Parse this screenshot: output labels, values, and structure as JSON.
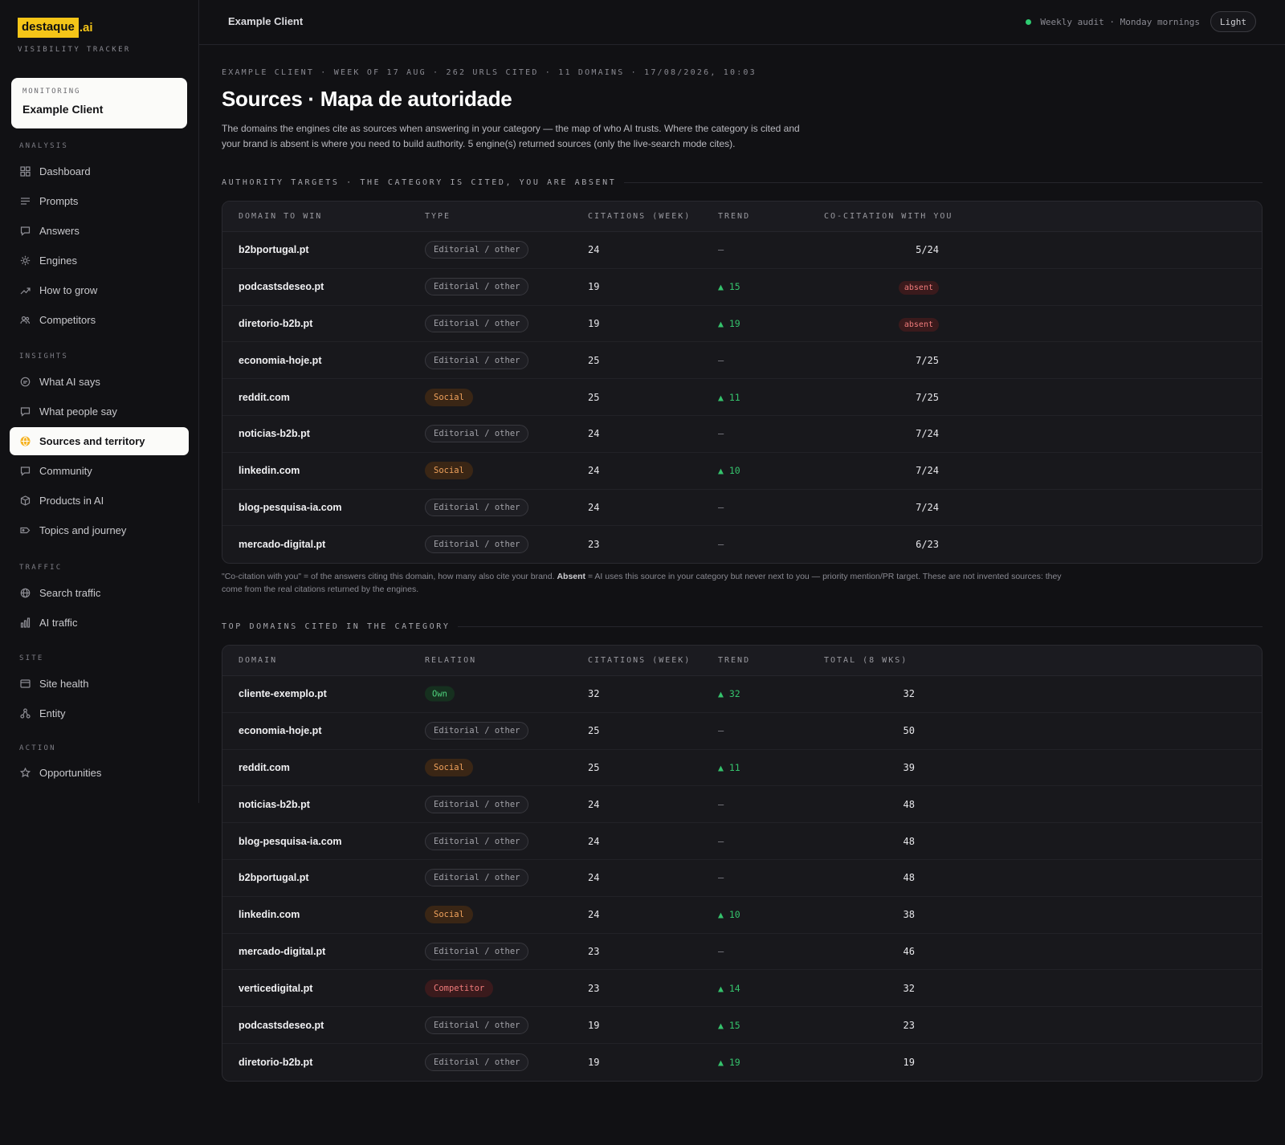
{
  "brand": {
    "name": "destaque",
    "ext": ".ai",
    "subtitle": "VISIBILITY TRACKER"
  },
  "client_card": {
    "label": "MONITORING",
    "name": "Example Client"
  },
  "nav": {
    "sections": [
      {
        "label": "ANALYSIS",
        "items": [
          {
            "label": "Dashboard",
            "icon": "grid-icon"
          },
          {
            "label": "Prompts",
            "icon": "lines-icon"
          },
          {
            "label": "Answers",
            "icon": "chat-icon"
          },
          {
            "label": "Engines",
            "icon": "gear-icon"
          },
          {
            "label": "How to grow",
            "icon": "trend-icon"
          },
          {
            "label": "Competitors",
            "icon": "users-icon"
          }
        ]
      },
      {
        "label": "INSIGHTS",
        "items": [
          {
            "label": "What AI says",
            "icon": "circle-icon"
          },
          {
            "label": "What people say",
            "icon": "chat-icon"
          },
          {
            "label": "Sources and territory",
            "icon": "globe-icon",
            "active": true
          },
          {
            "label": "Community",
            "icon": "chat-icon"
          },
          {
            "label": "Products in AI",
            "icon": "box-icon"
          },
          {
            "label": "Topics and journey",
            "icon": "tag-icon"
          }
        ]
      },
      {
        "label": "TRAFFIC",
        "items": [
          {
            "label": "Search traffic",
            "icon": "globe-icon"
          },
          {
            "label": "AI traffic",
            "icon": "bars-icon"
          }
        ]
      },
      {
        "label": "SITE",
        "items": [
          {
            "label": "Site health",
            "icon": "window-icon"
          },
          {
            "label": "Entity",
            "icon": "nodes-icon"
          }
        ]
      },
      {
        "label": "ACTION",
        "items": [
          {
            "label": "Opportunities",
            "icon": "star-icon"
          }
        ]
      }
    ]
  },
  "topbar": {
    "breadcrumb": "Example Client",
    "status": "Weekly audit · Monday mornings",
    "theme_button": "Light",
    "status_color": "#2ecc71"
  },
  "page": {
    "meta": "EXAMPLE CLIENT · WEEK OF 17 AUG · 262 URLS CITED · 11 DOMAINS · 17/08/2026, 10:03",
    "title": "Sources · Mapa de autoridade",
    "description": "The domains the engines cite as sources when answering in your category — the map of who AI trusts. Where the category is cited and your brand is absent is where you need to build authority. 5 engine(s) returned sources (only the live-search mode cites)."
  },
  "authority": {
    "heading": "AUTHORITY TARGETS · THE CATEGORY IS CITED, YOU ARE ABSENT",
    "columns": [
      "DOMAIN TO WIN",
      "TYPE",
      "CITATIONS (WEEK)",
      "TREND",
      "CO-CITATION WITH YOU"
    ],
    "rows": [
      {
        "domain": "b2bportugal.pt",
        "type": "Editorial / other",
        "type_kind": "editorial",
        "citations": "24",
        "trend": "—",
        "trend_up": false,
        "cocite": "5/24"
      },
      {
        "domain": "podcastsdeseo.pt",
        "type": "Editorial / other",
        "type_kind": "editorial",
        "citations": "19",
        "trend": "▲ 15",
        "trend_up": true,
        "cocite": "absent",
        "absent": true
      },
      {
        "domain": "diretorio-b2b.pt",
        "type": "Editorial / other",
        "type_kind": "editorial",
        "citations": "19",
        "trend": "▲ 19",
        "trend_up": true,
        "cocite": "absent",
        "absent": true
      },
      {
        "domain": "economia-hoje.pt",
        "type": "Editorial / other",
        "type_kind": "editorial",
        "citations": "25",
        "trend": "—",
        "trend_up": false,
        "cocite": "7/25"
      },
      {
        "domain": "reddit.com",
        "type": "Social",
        "type_kind": "social",
        "citations": "25",
        "trend": "▲ 11",
        "trend_up": true,
        "cocite": "7/25"
      },
      {
        "domain": "noticias-b2b.pt",
        "type": "Editorial / other",
        "type_kind": "editorial",
        "citations": "24",
        "trend": "—",
        "trend_up": false,
        "cocite": "7/24"
      },
      {
        "domain": "linkedin.com",
        "type": "Social",
        "type_kind": "social",
        "citations": "24",
        "trend": "▲ 10",
        "trend_up": true,
        "cocite": "7/24"
      },
      {
        "domain": "blog-pesquisa-ia.com",
        "type": "Editorial / other",
        "type_kind": "editorial",
        "citations": "24",
        "trend": "—",
        "trend_up": false,
        "cocite": "7/24"
      },
      {
        "domain": "mercado-digital.pt",
        "type": "Editorial / other",
        "type_kind": "editorial",
        "citations": "23",
        "trend": "—",
        "trend_up": false,
        "cocite": "6/23"
      }
    ],
    "footnote_pre": "\"Co-citation with you\" = of the answers citing this domain, how many also cite your brand. ",
    "footnote_bold": "Absent",
    "footnote_post": " = AI uses this source in your category but never next to you — priority mention/PR target. These are not invented sources: they come from the real citations returned by the engines."
  },
  "top_domains": {
    "heading": "TOP DOMAINS CITED IN THE CATEGORY",
    "columns": [
      "DOMAIN",
      "RELATION",
      "CITATIONS (WEEK)",
      "TREND",
      "TOTAL (8 WKS)"
    ],
    "rows": [
      {
        "domain": "cliente-exemplo.pt",
        "type": "Own",
        "type_kind": "own",
        "citations": "32",
        "trend": "▲ 32",
        "trend_up": true,
        "total": "32"
      },
      {
        "domain": "economia-hoje.pt",
        "type": "Editorial / other",
        "type_kind": "editorial",
        "citations": "25",
        "trend": "—",
        "trend_up": false,
        "total": "50"
      },
      {
        "domain": "reddit.com",
        "type": "Social",
        "type_kind": "social",
        "citations": "25",
        "trend": "▲ 11",
        "trend_up": true,
        "total": "39"
      },
      {
        "domain": "noticias-b2b.pt",
        "type": "Editorial / other",
        "type_kind": "editorial",
        "citations": "24",
        "trend": "—",
        "trend_up": false,
        "total": "48"
      },
      {
        "domain": "blog-pesquisa-ia.com",
        "type": "Editorial / other",
        "type_kind": "editorial",
        "citations": "24",
        "trend": "—",
        "trend_up": false,
        "total": "48"
      },
      {
        "domain": "b2bportugal.pt",
        "type": "Editorial / other",
        "type_kind": "editorial",
        "citations": "24",
        "trend": "—",
        "trend_up": false,
        "total": "48"
      },
      {
        "domain": "linkedin.com",
        "type": "Social",
        "type_kind": "social",
        "citations": "24",
        "trend": "▲ 10",
        "trend_up": true,
        "total": "38"
      },
      {
        "domain": "mercado-digital.pt",
        "type": "Editorial / other",
        "type_kind": "editorial",
        "citations": "23",
        "trend": "—",
        "trend_up": false,
        "total": "46"
      },
      {
        "domain": "verticedigital.pt",
        "type": "Competitor",
        "type_kind": "competitor",
        "citations": "23",
        "trend": "▲ 14",
        "trend_up": true,
        "total": "32"
      },
      {
        "domain": "podcastsdeseo.pt",
        "type": "Editorial / other",
        "type_kind": "editorial",
        "citations": "19",
        "trend": "▲ 15",
        "trend_up": true,
        "total": "23"
      },
      {
        "domain": "diretorio-b2b.pt",
        "type": "Editorial / other",
        "type_kind": "editorial",
        "citations": "19",
        "trend": "▲ 19",
        "trend_up": true,
        "total": "19"
      }
    ]
  }
}
